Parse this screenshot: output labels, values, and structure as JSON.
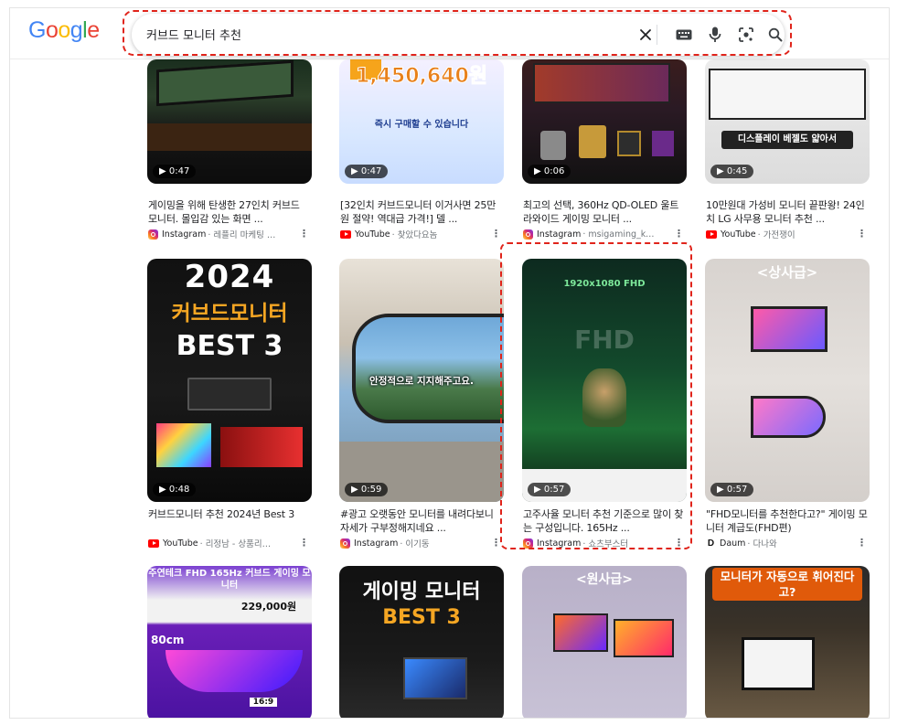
{
  "header": {
    "logo_letters": [
      {
        "char": "G",
        "color": "#4285F4"
      },
      {
        "char": "o",
        "color": "#EA4335"
      },
      {
        "char": "o",
        "color": "#FBBC05"
      },
      {
        "char": "g",
        "color": "#4285F4"
      },
      {
        "char": "l",
        "color": "#34A853"
      },
      {
        "char": "e",
        "color": "#EA4335"
      }
    ],
    "search_value": "커브드 모니터 추천",
    "icons": [
      "clear-icon",
      "keyboard-icon",
      "microphone-icon",
      "lens-icon",
      "search-icon"
    ]
  },
  "results": [
    {
      "duration": "0:47",
      "title": "게이밍을 위해 탄생한 27인치 커브드 모니터. 몰입감 있는 화면 ...",
      "platform": "Instagram",
      "channel": "레플리 마케팅 담당- ...",
      "overlay": ""
    },
    {
      "duration": "0:47",
      "title": "[32인치 커브드모니터 이거사면 25만원 절약! 역대급 가격!] 델 ...",
      "platform": "YouTube",
      "channel": "찾았다요놈",
      "overlay": "1,450,640원",
      "overlay2": "즉시 구매할 수 있습니다"
    },
    {
      "duration": "0:06",
      "title": "최고의 선택, 360Hz QD-OLED 울트라와이드 게이밍 모니터 ...",
      "platform": "Instagram",
      "channel": "msigaming_korea",
      "overlay": ""
    },
    {
      "duration": "0:45",
      "title": "10만원대 가성비 모니터 끝판왕! 24인치 LG 사무용 모니터 추천 ...",
      "platform": "YouTube",
      "channel": "가전쟁이",
      "overlay": "디스플레이 베젤도 얇아서"
    },
    {
      "duration": "0:48",
      "title": "커브드모니터 추천 2024년 Best 3",
      "platform": "YouTube",
      "channel": "리정남 - 상품리뷰정리...",
      "overlay": "2024",
      "overlay2": "커브드모니터",
      "overlay3": "BEST 3"
    },
    {
      "duration": "0:59",
      "title": "#광고 오랫동안 모니터를 내려다보니 자세가 구부정해지네요 ...",
      "platform": "Instagram",
      "channel": "이기동",
      "overlay": "안정적으로 지지해주고요."
    },
    {
      "duration": "0:57",
      "title": "고주사율 모니터 추천 기준으로 많이 찾는 구성입니다. 165Hz ...",
      "platform": "Instagram",
      "channel": "쇼츠부스터",
      "overlay": "1920x1080 FHD",
      "overlay2": "FHD"
    },
    {
      "duration": "0:57",
      "title": "\"FHD모니터를 추천한다고?\" 게이밍 모니터 계급도(FHD편)",
      "platform": "Daum",
      "channel": "다나와",
      "overlay": "<상사급>"
    },
    {
      "duration": "",
      "title": "",
      "platform": "",
      "channel": "",
      "overlay": "주연테크 FHD 165Hz 커브드 게이밍 모니터",
      "overlay2": "229,000원",
      "overlay3": "80cm",
      "overlay4": "16:9"
    },
    {
      "duration": "",
      "title": "",
      "platform": "",
      "channel": "",
      "overlay": "게이밍 모니터",
      "overlay2": "BEST 3"
    },
    {
      "duration": "",
      "title": "",
      "platform": "",
      "channel": "",
      "overlay": "<원사급>"
    },
    {
      "duration": "",
      "title": "",
      "platform": "",
      "channel": "",
      "overlay": "모니터가 자동으로 휘어진다고?"
    }
  ],
  "colors": {
    "highlight": "#e0241b"
  }
}
